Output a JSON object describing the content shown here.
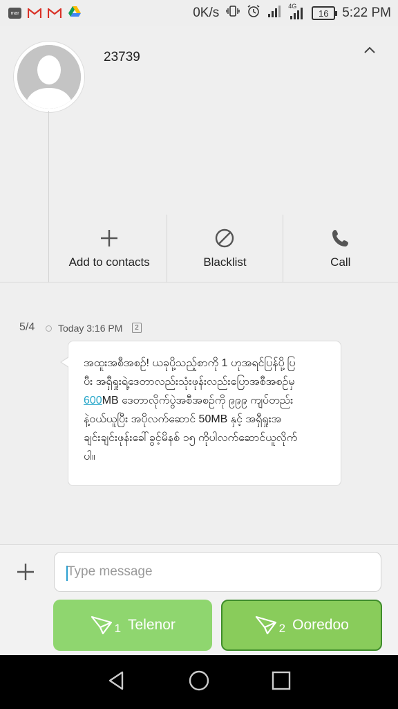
{
  "status_bar": {
    "left_icons": [
      "app-icon",
      "gmail-icon",
      "gmail-icon",
      "drive-icon"
    ],
    "app_icon_text": "mar",
    "network_speed": "0K/s",
    "network_type": "4G",
    "battery": "16",
    "time": "5:22 PM"
  },
  "header": {
    "contact_number": "23739",
    "actions": [
      {
        "icon": "plus-icon",
        "label": "Add to contacts"
      },
      {
        "icon": "block-icon",
        "label": "Blacklist"
      },
      {
        "icon": "phone-icon",
        "label": "Call"
      }
    ]
  },
  "conversation": {
    "date": "5/4",
    "time": "Today 3:16 PM",
    "sim_badge": "2",
    "message": {
      "line1": "အထူးအစီအစဉ်! ယခုပို့သည့်စာကို 1 ဟုအရင်ပြန်ပို့ပြ",
      "line2": "ပီး အရှီရှုးရဲ့ဒေတာလည်းသုံးဖုန်းလည်းပြောအစီအစဉ်မှ",
      "line3_link": "600",
      "line3_rest": "MB ဒေတာလိုက်ပွဲအစီအစဉ်ကို ၉၉၉ ကျပ်တည်း",
      "line4": "နဲ့ဝယ်ယူပြီး အပိုလက်ဆောင် 50MB  နှင့်  အရှီရှုးအ",
      "line5": "ချင်းချင်းဖုန်းခေါ်ခွင့်မိနစ်  ၁၅ ကိုပါလက်ဆောင်ယူလိုက်",
      "line6": "ပါ။"
    }
  },
  "compose": {
    "placeholder": "Type message",
    "send_buttons": [
      {
        "sim": "1",
        "label": "Telenor"
      },
      {
        "sim": "2",
        "label": "Ooredoo"
      }
    ]
  },
  "navbar": {
    "buttons": [
      "back-icon",
      "home-icon",
      "recents-icon"
    ]
  }
}
